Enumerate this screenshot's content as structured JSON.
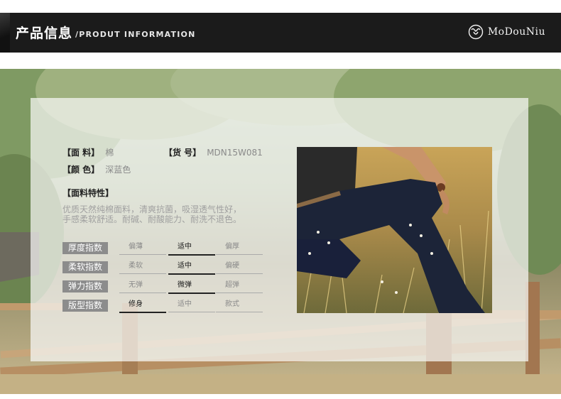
{
  "header": {
    "title_cn": "产品信息",
    "title_en": "/PRODUT INFORMATION",
    "brand": "MoDouNiu"
  },
  "specs": {
    "fabric_label": "【面 料】",
    "fabric_value": "棉",
    "item_no_label": "【货 号】",
    "item_no_value": "MDN15W081",
    "color_label": "【颜 色】",
    "color_value": "深蓝色"
  },
  "features": {
    "title": "【面料特性】",
    "line1": "优质天然纯棉面料，清爽抗菌，吸湿透气性好，",
    "line2": "手感柔软舒适。耐碱、耐酸能力、耐洗不退色。"
  },
  "indices": [
    {
      "label": "厚度指数",
      "options": [
        "偏薄",
        "适中",
        "偏厚"
      ],
      "selected": 1
    },
    {
      "label": "柔软指数",
      "options": [
        "柔软",
        "适中",
        "偏硬"
      ],
      "selected": 1
    },
    {
      "label": "弹力指数",
      "options": [
        "无弹",
        "微弹",
        "超弹"
      ],
      "selected": 1
    },
    {
      "label": "版型指数",
      "options": [
        "修身",
        "适中",
        "款式"
      ],
      "selected": 0
    }
  ],
  "colors": {
    "header_bg": "#1b1b1b",
    "label_bg": "#8c8c8c",
    "jeans": "#1c2438"
  }
}
